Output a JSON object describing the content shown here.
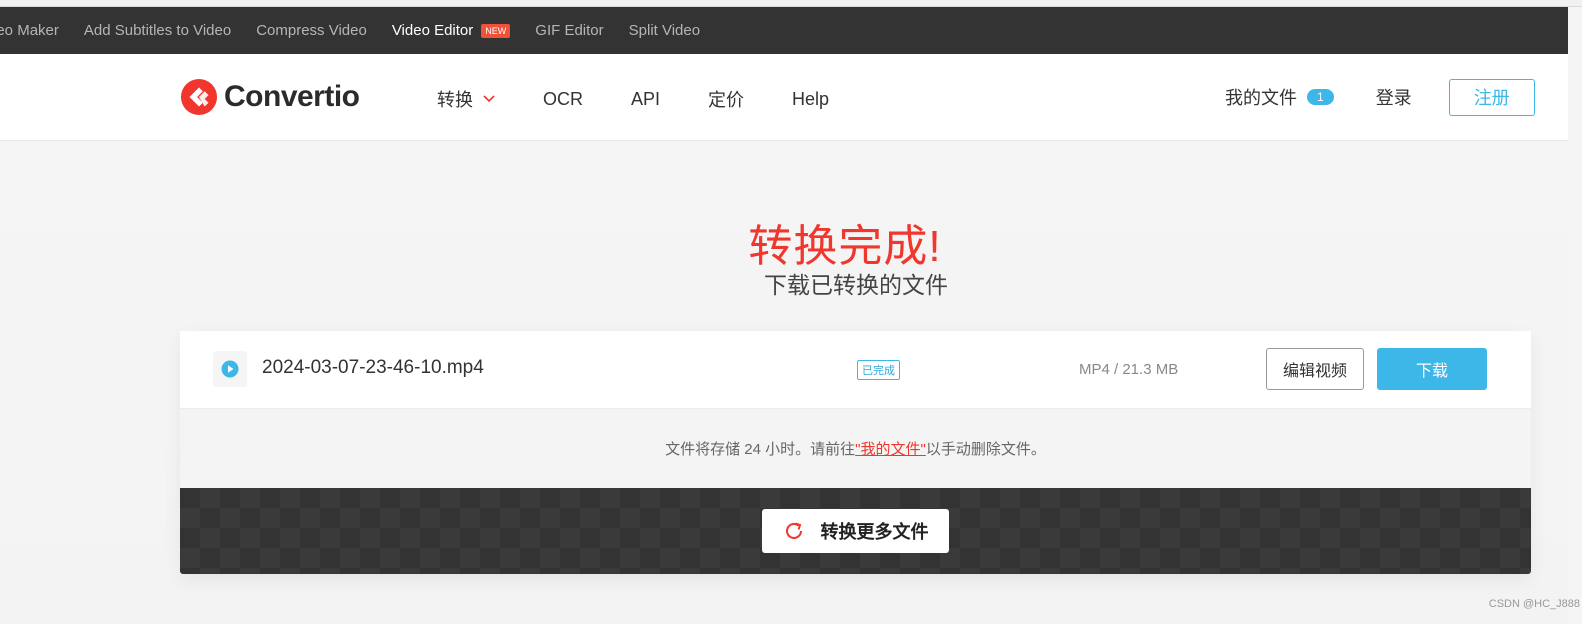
{
  "topbar": {
    "items": [
      {
        "label": "deo Maker"
      },
      {
        "label": "Add Subtitles to Video"
      },
      {
        "label": "Compress Video"
      },
      {
        "label": "Video Editor",
        "badge": "NEW"
      },
      {
        "label": "GIF Editor"
      },
      {
        "label": "Split Video"
      }
    ]
  },
  "header": {
    "brand": "Convertio",
    "nav": {
      "convert": "转换",
      "ocr": "OCR",
      "api": "API",
      "pricing": "定价",
      "help": "Help"
    },
    "my_files": "我的文件",
    "my_files_count": "1",
    "login": "登录",
    "signup": "注册"
  },
  "main": {
    "title": "转换完成!",
    "subtitle": "下载已转换的文件",
    "file": {
      "name": "2024-03-07-23-46-10.mp4",
      "status": "已完成",
      "size": "MP4 / 21.3 MB",
      "edit_label": "编辑视频",
      "download_label": "下载"
    },
    "note": {
      "before": "文件将存储 24 小时。请前往",
      "link": "\"我的文件\"",
      "after": "以手动删除文件。"
    },
    "convert_more": "转换更多文件"
  },
  "watermark": "CSDN @HC_J888",
  "colors": {
    "accent": "#3db6e8",
    "brand_red": "#f0362d",
    "topbar_bg": "#333333"
  }
}
